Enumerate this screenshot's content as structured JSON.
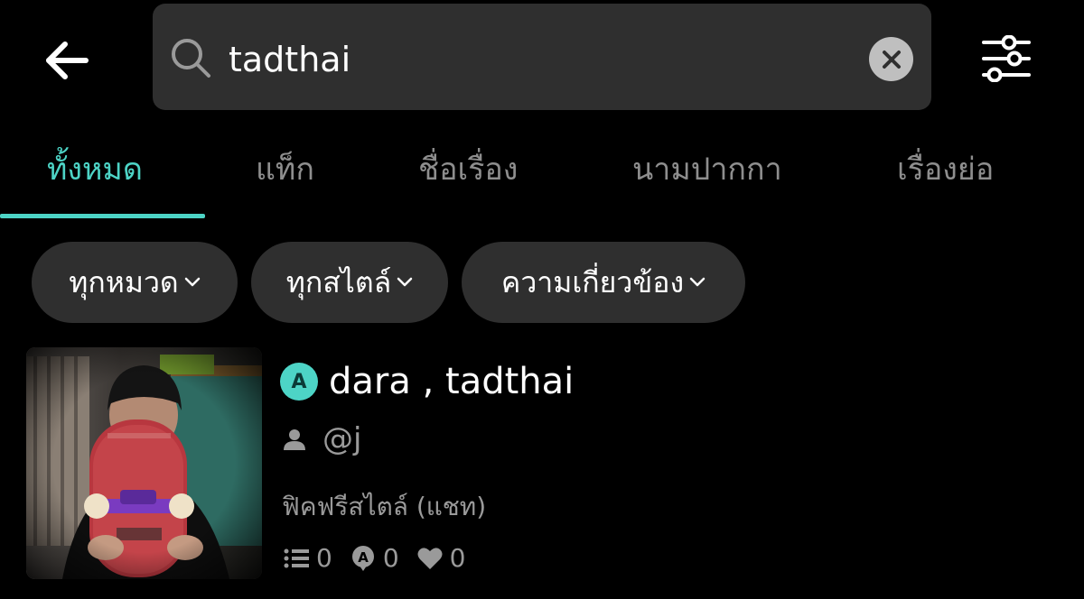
{
  "search": {
    "query": "tadthai"
  },
  "tabs": [
    {
      "label": "ทั้งหมด",
      "active": true
    },
    {
      "label": "แท็ก",
      "active": false
    },
    {
      "label": "ชื่อเรื่อง",
      "active": false
    },
    {
      "label": "นามปากกา",
      "active": false
    },
    {
      "label": "เรื่องย่อ",
      "active": false
    }
  ],
  "filters": {
    "category": "ทุกหมวด",
    "style": "ทุกสไตล์",
    "sort": "ความเกี่ยวข้อง"
  },
  "result": {
    "title": "dara , tadthai",
    "badge_letter": "A",
    "author": "@j",
    "category": "ฟิคฟรีสไตล์ (แชท)",
    "chapters": "0",
    "comments": "0",
    "likes": "0"
  },
  "colors": {
    "accent": "#4dd4c6",
    "surface": "#2f2f2f",
    "muted_text": "#9a9a9a",
    "background": "#000000"
  },
  "icons": {
    "back": "arrow-left-icon",
    "search": "search-icon",
    "clear": "close-icon",
    "filter": "sliders-icon",
    "chevron": "chevron-down-icon",
    "author": "person-icon",
    "chapters": "list-icon",
    "comments": "comment-icon",
    "likes": "heart-icon"
  }
}
